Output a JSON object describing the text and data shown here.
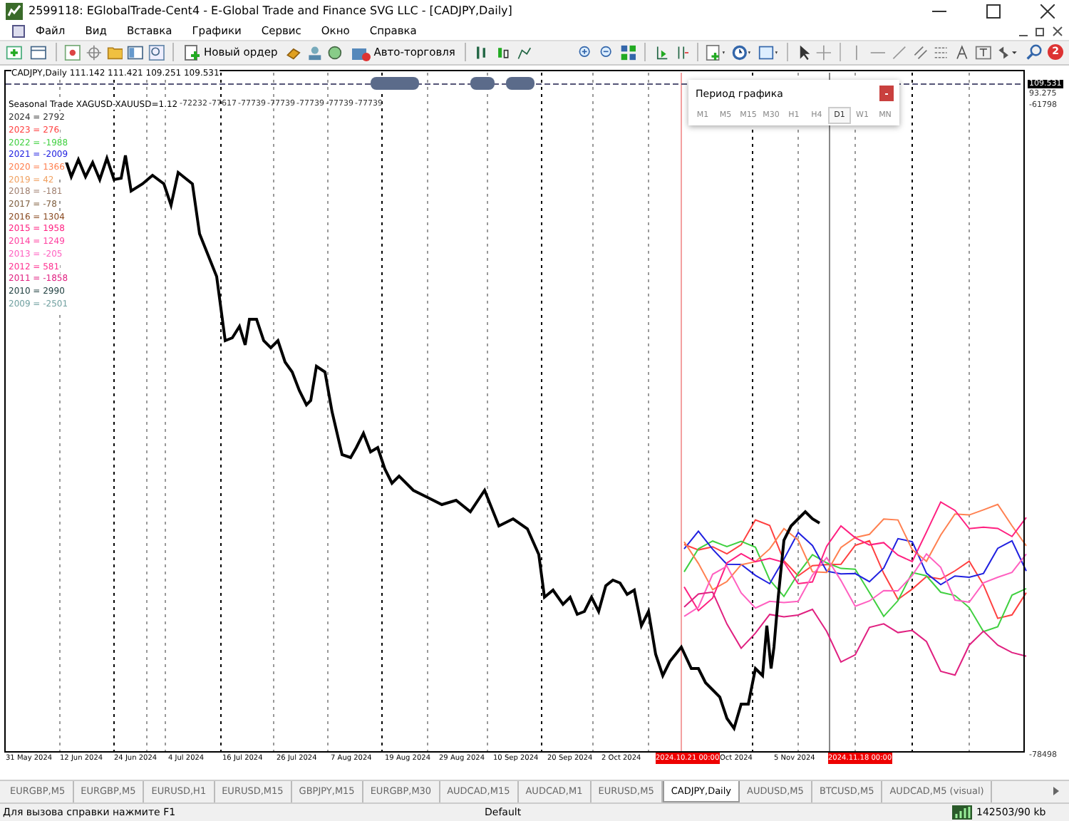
{
  "window": {
    "title": "2599118: EGlobalTrade-Cent4 - E-Global Trade and Finance SVG LLC - [CADJPY,Daily]"
  },
  "menu": [
    "Файл",
    "Вид",
    "Вставка",
    "Графики",
    "Сервис",
    "Окно",
    "Справка"
  ],
  "toolbar": {
    "new_order": "Новый ордер",
    "auto_trading": "Авто-торговля",
    "notifications": "2"
  },
  "chart": {
    "header": "CADJPY,Daily  111.142 111.421 109.251 109.531",
    "indicator": "Seasonal Trade XAGUSD-XAUUSD=1.12",
    "indicator_values": [
      "-72232",
      "-77617",
      "-77739",
      "-77739",
      "-77739",
      "-77739",
      "-77739"
    ],
    "legend": [
      {
        "text": "2024 = 2792",
        "color": "#303030"
      },
      {
        "text": "2023 = 276",
        "color": "#ff4040"
      },
      {
        "text": "2022 = -1988",
        "color": "#40d040"
      },
      {
        "text": "2021 = -2009",
        "color": "#2020e0"
      },
      {
        "text": "2020 = 1366",
        "color": "#ff8050"
      },
      {
        "text": "2019 = 42",
        "color": "#f0a060"
      },
      {
        "text": "2018 = -181",
        "color": "#a08070"
      },
      {
        "text": "2017 = -78",
        "color": "#806040"
      },
      {
        "text": "2016 = 1304",
        "color": "#8a4a20"
      },
      {
        "text": "2015 = 1958",
        "color": "#ff2080"
      },
      {
        "text": "2014 = 1249",
        "color": "#ff40a0"
      },
      {
        "text": "2013 = -205",
        "color": "#ff60c0"
      },
      {
        "text": "2012 = 581",
        "color": "#ff3090"
      },
      {
        "text": "2011 = -1858",
        "color": "#e02080"
      },
      {
        "text": "2010 = 2990",
        "color": "#204040"
      },
      {
        "text": "2009 = -2501",
        "color": "#70a0a0"
      }
    ],
    "price_labels": [
      {
        "text": "109.531",
        "kind": "current"
      },
      {
        "text": "93.275",
        "kind": "plain"
      },
      {
        "text": "-61798",
        "kind": "plain"
      }
    ],
    "bottom_price": "-78498",
    "dates": [
      {
        "text": "31 May 2024",
        "kind": "plain"
      },
      {
        "text": "12 Jun 2024",
        "kind": "plain"
      },
      {
        "text": "24 Jun 2024",
        "kind": "plain"
      },
      {
        "text": "4 Jul 2024",
        "kind": "plain"
      },
      {
        "text": "16 Jul 2024",
        "kind": "plain"
      },
      {
        "text": "26 Jul 2024",
        "kind": "plain"
      },
      {
        "text": "7 Aug 2024",
        "kind": "plain"
      },
      {
        "text": "19 Aug 2024",
        "kind": "plain"
      },
      {
        "text": "29 Aug 2024",
        "kind": "plain"
      },
      {
        "text": "10 Sep 2024",
        "kind": "plain"
      },
      {
        "text": "20 Sep 2024",
        "kind": "plain"
      },
      {
        "text": "2 Oct 2024",
        "kind": "plain"
      },
      {
        "text": "2024.10.21 00:00",
        "kind": "marker"
      },
      {
        "text": "Oct 2024",
        "kind": "plain"
      },
      {
        "text": "5 Nov 2024",
        "kind": "plain"
      },
      {
        "text": "2024.11.18 00:00",
        "kind": "marker"
      }
    ]
  },
  "period_panel": {
    "title": "Период графика",
    "periods": [
      {
        "label": "M1",
        "selected": false
      },
      {
        "label": "M5",
        "selected": false
      },
      {
        "label": "M15",
        "selected": false
      },
      {
        "label": "M30",
        "selected": false
      },
      {
        "label": "H1",
        "selected": false
      },
      {
        "label": "H4",
        "selected": false
      },
      {
        "label": "D1",
        "selected": true
      },
      {
        "label": "W1",
        "selected": false
      },
      {
        "label": "MN",
        "selected": false
      }
    ]
  },
  "tabs": [
    {
      "label": "EURGBP,M5",
      "selected": false
    },
    {
      "label": "EURGBP,M5",
      "selected": false
    },
    {
      "label": "EURUSD,H1",
      "selected": false
    },
    {
      "label": "EURUSD,M15",
      "selected": false
    },
    {
      "label": "GBPJPY,M15",
      "selected": false
    },
    {
      "label": "EURGBP,M30",
      "selected": false
    },
    {
      "label": "AUDCAD,M15",
      "selected": false
    },
    {
      "label": "AUDCAD,M1",
      "selected": false
    },
    {
      "label": "EURUSD,M5",
      "selected": false
    },
    {
      "label": "CADJPY,Daily",
      "selected": true
    },
    {
      "label": "AUDUSD,M5",
      "selected": false
    },
    {
      "label": "BTCUSD,M5",
      "selected": false
    },
    {
      "label": "AUDCAD,M5 (visual)",
      "selected": false
    }
  ],
  "status_bar": {
    "help": "Для вызова справки нажмите F1",
    "profile": "Default",
    "traffic": "142503/90 kb"
  }
}
